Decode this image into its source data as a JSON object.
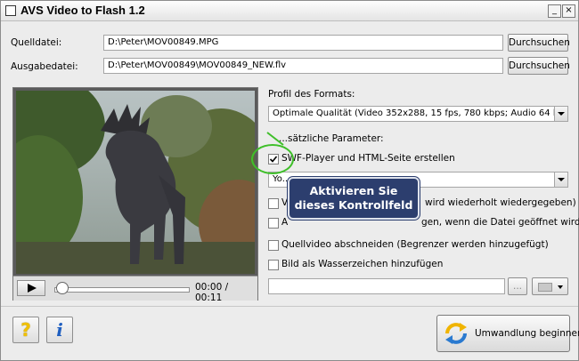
{
  "window": {
    "title": "AVS Video to Flash 1.2",
    "minimize_glyph": "_",
    "close_glyph": "×"
  },
  "source": {
    "label": "Quelldatei:",
    "value": "D:\\Peter\\MOV00849.MPG",
    "browse_label": "Durchsuchen"
  },
  "output": {
    "label": "Ausgabedatei:",
    "value": "D:\\Peter\\MOV00849\\MOV00849_NEW.flv",
    "browse_label": "Durchsuchen"
  },
  "player": {
    "time": "00:00 / 00:11",
    "progress": 0
  },
  "profile": {
    "label": "Profil des Formats:",
    "value": "Optimale Qualität (Video 352x288, 15 fps, 780 kbps; Audio 64 kbps)"
  },
  "params": {
    "label": "...sätzliche Parameter:",
    "swf_player": {
      "label": "SWF-Player und HTML-Seite erstellen",
      "checked": true
    },
    "player_skin_value": "Yo...",
    "loop": {
      "label_start": "V",
      "label_end": "wird wiederholt wiedergegeben)",
      "checked": false
    },
    "autoplay": {
      "label_start": "A",
      "label_end": "gen, wenn die Datei geöffnet wird)",
      "checked": false
    },
    "trim": {
      "label": "Quellvideo abschneiden (Begrenzer werden hinzugefügt)",
      "checked": false
    },
    "watermark": {
      "label": "Bild als Wasserzeichen hinzufügen",
      "checked": false
    },
    "watermark_browse": "..."
  },
  "callout": {
    "line1": "Aktivieren Sie",
    "line2": "dieses Kontrollfeld"
  },
  "bottom": {
    "help_glyph": "?",
    "info_glyph": "i",
    "convert_label": "Umwandlung beginnen"
  },
  "colors": {
    "accent_green": "#3fbf2a",
    "callout_bg": "#2c3e6e",
    "help_yellow": "#f0c000",
    "info_blue": "#1f5fc0"
  }
}
